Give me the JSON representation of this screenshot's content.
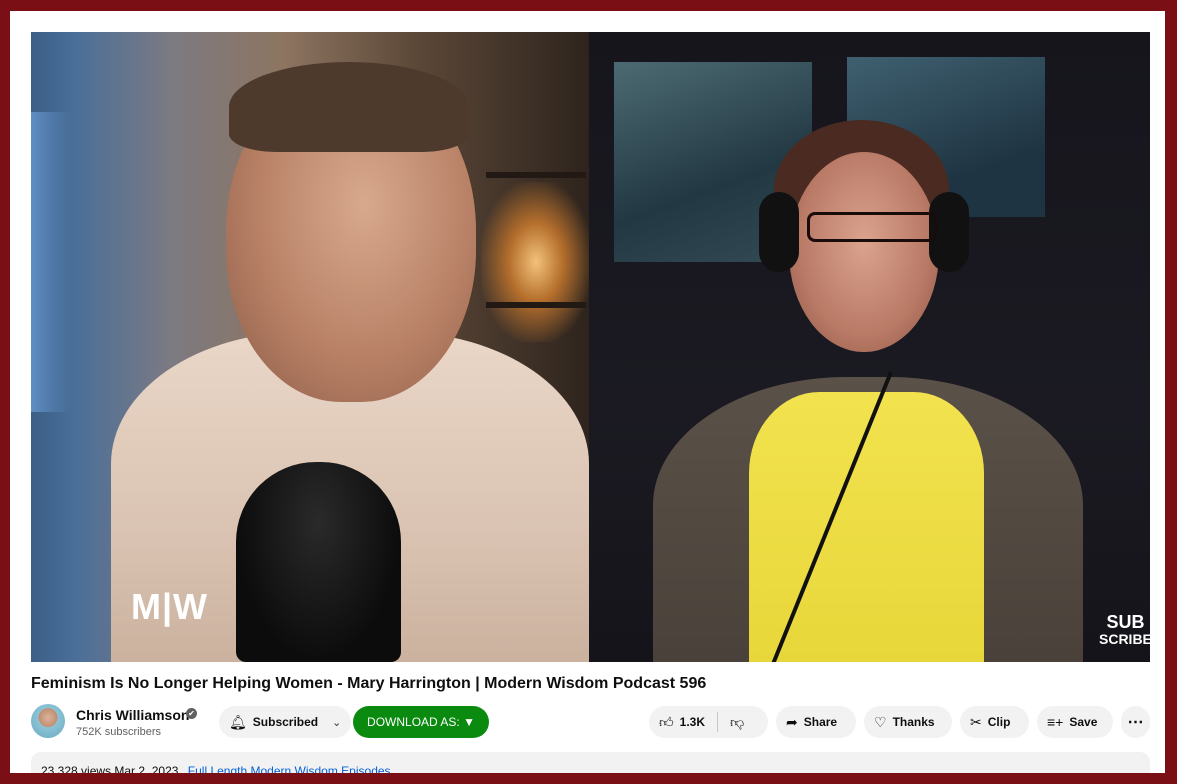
{
  "video": {
    "left_logo": "M|W",
    "right_logo_line1": "SUB",
    "right_logo_line2": "SCRIBE"
  },
  "title": "Feminism Is No Longer Helping Women - Mary Harrington | Modern Wisdom Podcast 596",
  "channel": {
    "name": "Chris Williamson",
    "verified_icon": "✔",
    "subscribers": "752K subscribers"
  },
  "actions": {
    "subscribed_label": "Subscribed",
    "download_label": "DOWNLOAD AS: ▼",
    "like_count": "1.3K",
    "share_label": "Share",
    "thanks_label": "Thanks",
    "clip_label": "Clip",
    "save_label": "Save",
    "more_label": "⋯"
  },
  "description": {
    "views": "23,328 views",
    "date": "Mar 2, 2023",
    "playlist_link": "Full Length Modern Wisdom Episodes"
  },
  "colors": {
    "frame_border": "#7a0f16",
    "download_button": "#0a8a0f",
    "link": "#065fd4"
  }
}
